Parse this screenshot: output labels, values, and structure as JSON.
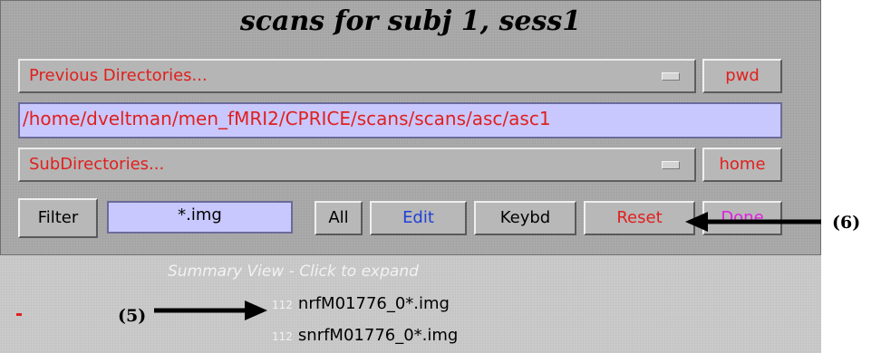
{
  "window": {
    "title": "scans for subj 1, sess1"
  },
  "previous_dirs": {
    "label": "Previous Directories...",
    "button": "pwd"
  },
  "path": {
    "value": "/home/dveltman/men_fMRI2/CPRICE/scans/scans/asc/asc1"
  },
  "subdirs": {
    "label": "SubDirectories...",
    "button": "home"
  },
  "filter": {
    "button": "Filter",
    "value": "*.img"
  },
  "actions": {
    "all": "All",
    "edit": "Edit",
    "keybd": "Keybd",
    "reset": "Reset",
    "done": "Done"
  },
  "summary": {
    "header": "Summary View - Click to expand",
    "files": [
      {
        "count": "112",
        "name": "nrfM01776_0*.img"
      },
      {
        "count": "112",
        "name": "snrfM01776_0*.img"
      }
    ]
  },
  "annotations": {
    "label5": "(5)",
    "label6": "(6)"
  },
  "colors": {
    "red_text": "#e0201d",
    "field_bg": "#c8c8ff",
    "blue_text": "#1f3fd8",
    "magenta_text": "#e020e0"
  }
}
